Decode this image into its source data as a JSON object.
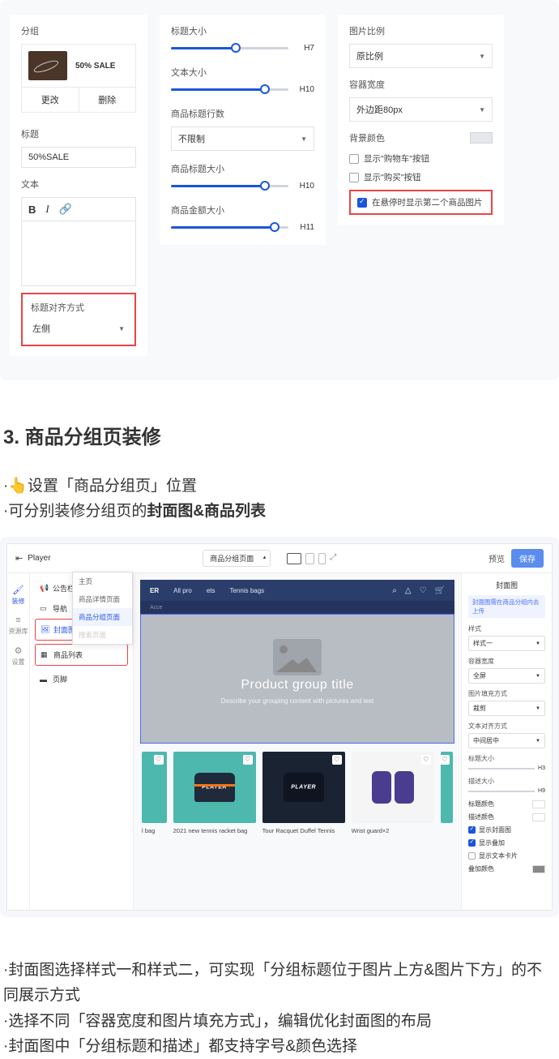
{
  "panel1": {
    "group_label": "分组",
    "sale_text": "50% SALE",
    "change_btn": "更改",
    "delete_btn": "删除",
    "title_label": "标题",
    "title_value": "50%SALE",
    "text_label": "文本",
    "align_label": "标题对齐方式",
    "align_value": "左侧"
  },
  "panel2": {
    "title_size_label": "标题大小",
    "title_size_val": "H7",
    "text_size_label": "文本大小",
    "text_size_val": "H10",
    "rows_label": "商品标题行数",
    "rows_value": "不限制",
    "prod_title_size_label": "商品标题大小",
    "prod_title_size_val": "H10",
    "prod_amount_size_label": "商品金额大小",
    "prod_amount_size_val": "H11"
  },
  "panel3": {
    "ratio_label": "图片比例",
    "ratio_value": "原比例",
    "width_label": "容器宽度",
    "width_value": "外边距80px",
    "bgcolor_label": "背景颜色",
    "check1": "显示\"购物车\"按钮",
    "check2": "显示\"购买\"按钮",
    "check3": "在悬停时显示第二个商品图片"
  },
  "heading": "3. 商品分组页装修",
  "bullet1_prefix": "·",
  "bullet1_text": "设置「商品分组页」位置",
  "bullet2_prefix": "·可分别装修分组页的",
  "bullet2_bold": "封面图&商品列表",
  "screenshot": {
    "player": "Player",
    "page_selector": "商品分组页面",
    "preview": "预览",
    "save": "保存",
    "leftbar": {
      "decorate": "装修",
      "resource": "资源库",
      "settings": "设置"
    },
    "sidebar": {
      "announce": "公告栏",
      "nav": "导航",
      "cover": "封面图",
      "list": "商品列表",
      "footer": "页脚"
    },
    "dropdown": {
      "home": "主页",
      "detail": "商品详情页面",
      "group": "商品分组页面",
      "search": "搜索页面"
    },
    "nav": {
      "brand": "ER",
      "item1": "All pro",
      "item2": "ets",
      "item3": "Tennis bags",
      "subnav": "Acce"
    },
    "hero": {
      "title": "Product group title",
      "desc": "Describe your grouping content with pictures and text"
    },
    "products": {
      "p1": "l bag",
      "p2": "2021 new tennis racket bag",
      "p3": "Tour Racquet Duffel Tennis",
      "p4": "Wrist guard×2",
      "brand_label": "PLAYER"
    },
    "rightpanel": {
      "title": "封面图",
      "notice": "封面图需在商品分组内去上传",
      "style_label": "样式",
      "style_value": "样式一",
      "width_label": "容器宽度",
      "width_value": "全屏",
      "fill_label": "图片填充方式",
      "fill_value": "裁剪",
      "align_label": "文本对齐方式",
      "align_value": "中间居中",
      "title_size_label": "标题大小",
      "title_size_val": "H3",
      "desc_size_label": "描述大小",
      "desc_size_val": "H9",
      "title_color": "标题颜色",
      "desc_color": "描述颜色",
      "check1": "显示封面图",
      "check2": "显示叠加",
      "check3": "显示文本卡片",
      "overlay_color": "叠加颜色"
    }
  },
  "bottom": {
    "line1": "·封面图选择样式一和样式二，可实现「分组标题位于图片上方&图片下方」的不同展示方式",
    "line2": "·选择不同「容器宽度和图片填充方式」，编辑优化封面图的布局",
    "line3": "·封面图中「分组标题和描述」都支持字号&颜色选择"
  }
}
